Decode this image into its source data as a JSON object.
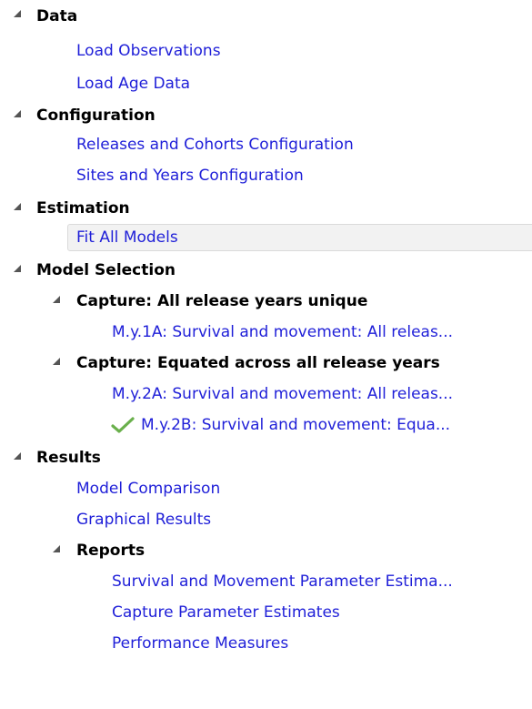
{
  "tree": {
    "data": {
      "label": "Data",
      "items": [
        "Load Observations",
        "Load Age Data"
      ]
    },
    "configuration": {
      "label": "Configuration",
      "items": [
        "Releases and Cohorts Configuration",
        "Sites and Years Configuration"
      ]
    },
    "estimation": {
      "label": "Estimation",
      "items": [
        "Fit All Models"
      ]
    },
    "model_selection": {
      "label": "Model Selection",
      "capture1": {
        "label": "Capture: All release years unique",
        "items": [
          "M.y.1A: Survival and movement: All releas..."
        ]
      },
      "capture2": {
        "label": "Capture: Equated across all release years",
        "items": [
          "M.y.2A: Survival and movement: All releas...",
          "M.y.2B: Survival and movement: Equa..."
        ]
      }
    },
    "results": {
      "label": "Results",
      "items": [
        "Model Comparison",
        "Graphical Results"
      ],
      "reports": {
        "label": "Reports",
        "items": [
          "Survival and Movement Parameter Estima...",
          "Capture Parameter Estimates",
          "Performance Measures"
        ]
      }
    }
  },
  "selected_item": "Fit All Models",
  "colors": {
    "link": "#1f1fd8",
    "header": "#000000",
    "check": "#6ab04c",
    "selection_bg": "#f2f2f2"
  },
  "icons": {
    "expander": "expanded-triangle-icon",
    "check": "checkmark-icon"
  }
}
